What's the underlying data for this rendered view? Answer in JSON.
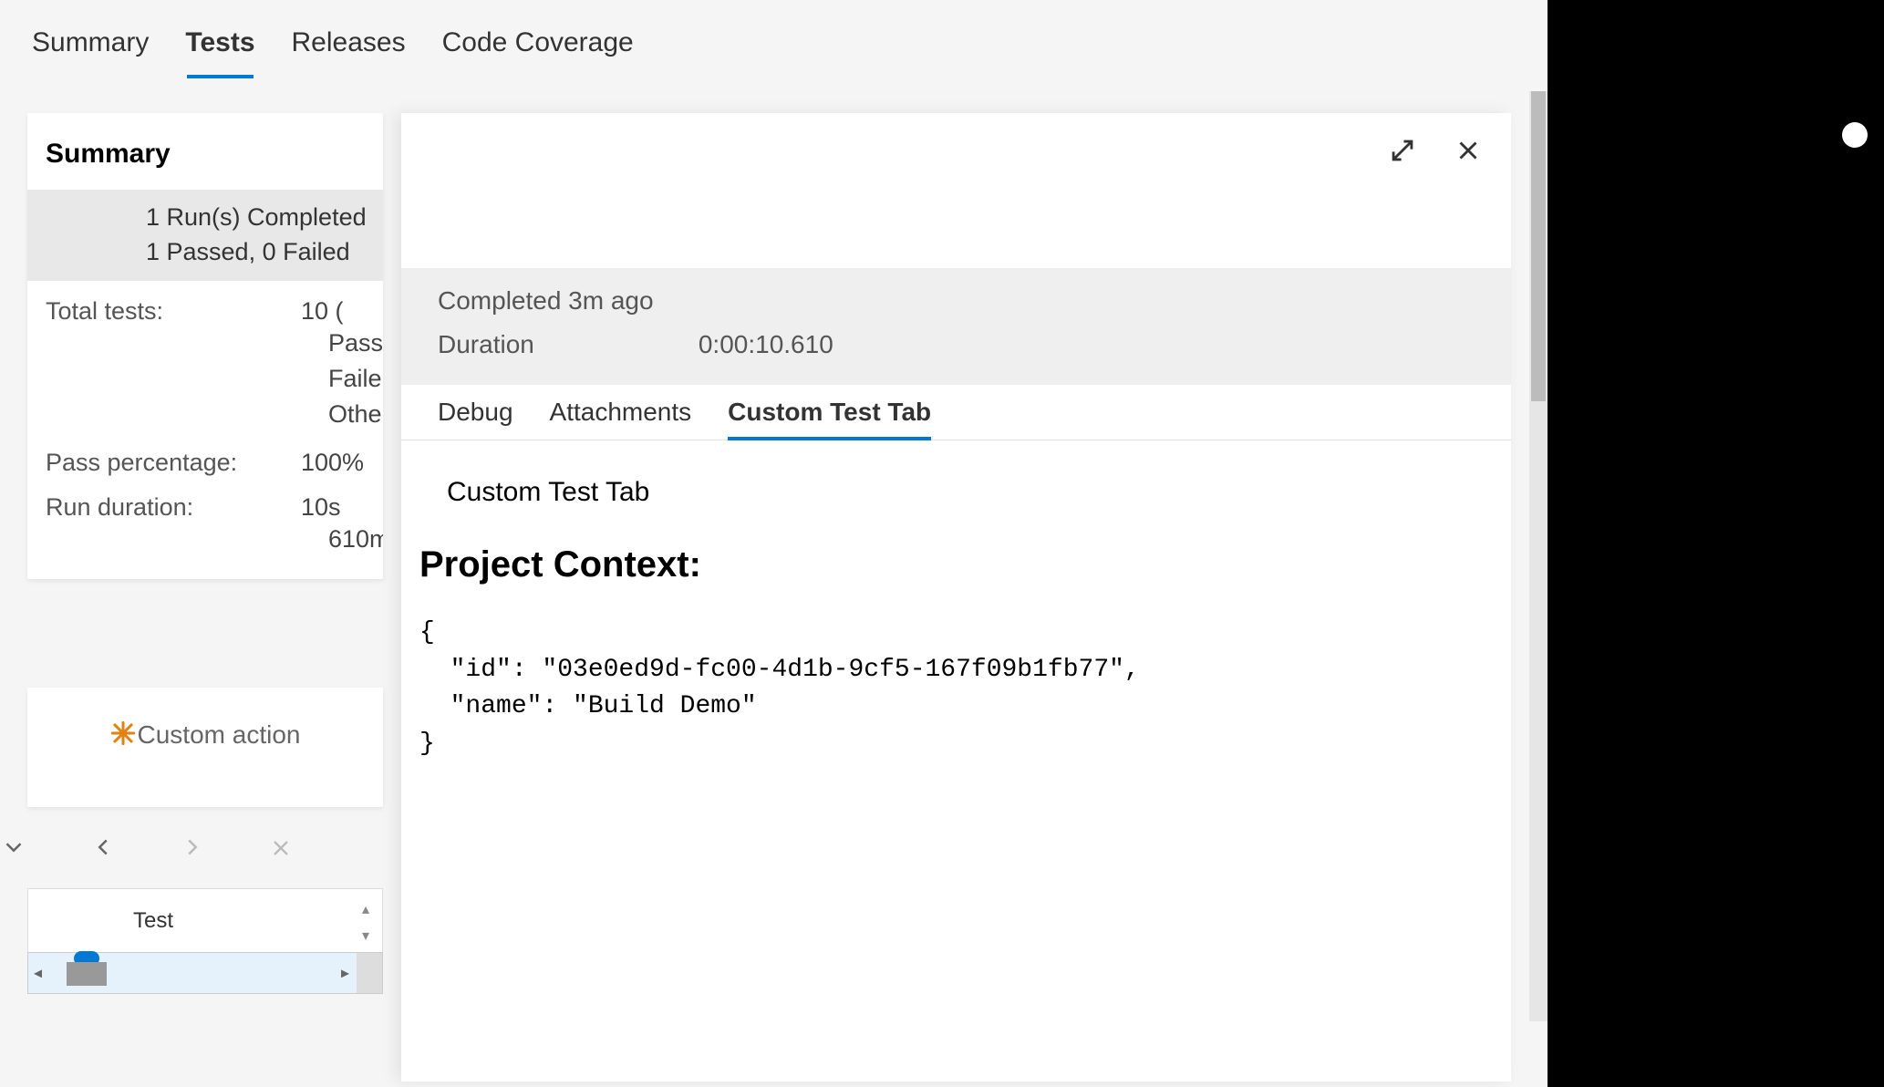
{
  "top_tabs": {
    "summary": "Summary",
    "tests": "Tests",
    "releases": "Releases",
    "code_coverage": "Code Coverage"
  },
  "summary_card": {
    "title": "Summary",
    "banner_line1": "1 Run(s) Completed",
    "banner_line2": "1 Passed, 0 Failed",
    "total_tests_label": "Total tests:",
    "total_tests_value": "10 (",
    "row_pass": "Pass",
    "row_fail": "Faile",
    "row_other": "Othe",
    "pass_pct_label": "Pass percentage:",
    "pass_pct_value": "100%",
    "run_duration_label": "Run duration:",
    "run_duration_value": "10s",
    "run_duration_value2": "610m"
  },
  "custom_action": {
    "label": "Custom action"
  },
  "grid": {
    "col_test": "Test"
  },
  "detail": {
    "completed": "Completed 3m ago",
    "duration_label": "Duration",
    "duration_value": "0:00:10.610",
    "tabs": {
      "debug": "Debug",
      "attachments": "Attachments",
      "custom": "Custom Test Tab"
    },
    "body": {
      "tab_title": "Custom Test Tab",
      "context_heading": "Project Context:",
      "json": "{\n  \"id\": \"03e0ed9d-fc00-4d1b-9cf5-167f09b1fb77\",\n  \"name\": \"Build Demo\"\n}"
    }
  }
}
